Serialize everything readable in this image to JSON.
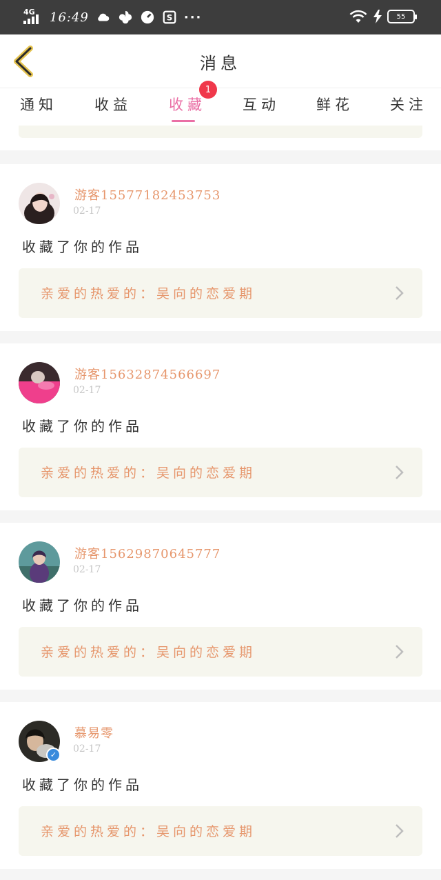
{
  "status_bar": {
    "network": "4G",
    "time": "16:49",
    "more": "···",
    "battery": "55"
  },
  "nav": {
    "title": "消息"
  },
  "tabs": [
    {
      "label": "通知"
    },
    {
      "label": "收益"
    },
    {
      "label": "收藏",
      "active": true,
      "badge": "1"
    },
    {
      "label": "互动"
    },
    {
      "label": "鲜花"
    },
    {
      "label": "关注"
    }
  ],
  "colors": {
    "accent_pink": "#ea6fa5",
    "username_orange": "#e6966c",
    "badge_red": "#f0384b",
    "quote_bg": "#f6f6ee"
  },
  "messages": [
    {
      "username": "游客15577182453753",
      "date": "02-17",
      "action": "收藏了你的作品",
      "quote": "亲爱的热爱的：吴向的恋爱期",
      "avatar_icon": "user-avatar-photo"
    },
    {
      "username": "游客15632874566697",
      "date": "02-17",
      "action": "收藏了你的作品",
      "quote": "亲爱的热爱的：吴向的恋爱期",
      "avatar_icon": "user-avatar-photo"
    },
    {
      "username": "游客15629870645777",
      "date": "02-17",
      "action": "收藏了你的作品",
      "quote": "亲爱的热爱的：吴向的恋爱期",
      "avatar_icon": "user-avatar-photo"
    },
    {
      "username": "慕易零",
      "date": "02-17",
      "action": "收藏了你的作品",
      "quote": "亲爱的热爱的：吴向的恋爱期",
      "avatar_icon": "user-avatar-photo",
      "verified": true
    }
  ]
}
